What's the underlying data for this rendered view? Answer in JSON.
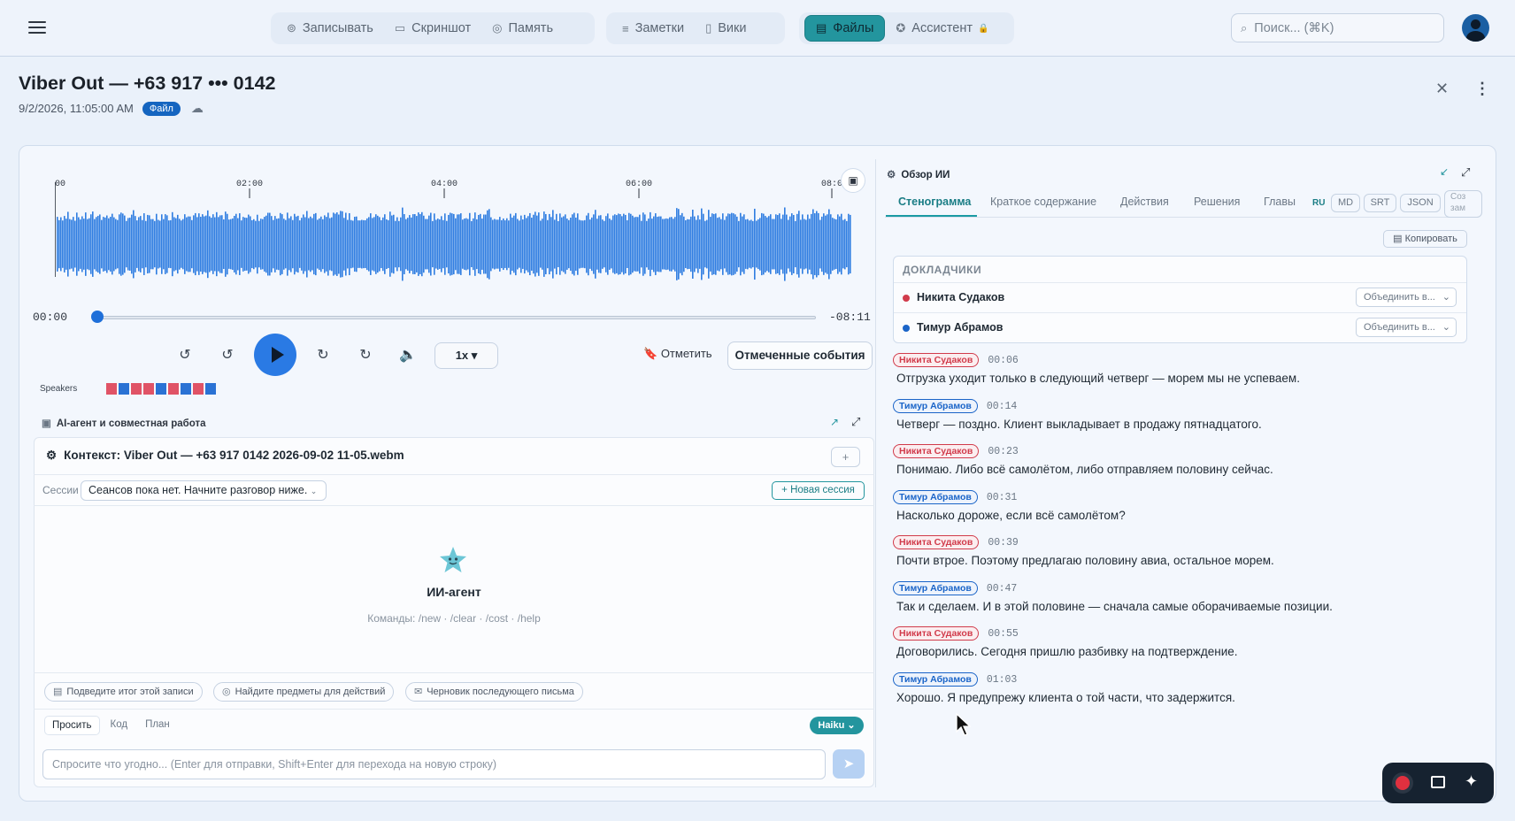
{
  "nav": {
    "groups": [
      [
        {
          "icon": "record-icon",
          "glyph": "⊚",
          "label": "Записывать"
        },
        {
          "icon": "screenshot-icon",
          "glyph": "▭",
          "label": "Скриншот"
        },
        {
          "icon": "memory-icon",
          "glyph": "◎",
          "label": "Память"
        }
      ],
      [
        {
          "icon": "notes-icon",
          "glyph": "≡",
          "label": "Заметки"
        },
        {
          "icon": "wiki-icon",
          "glyph": "▯",
          "label": "Вики"
        }
      ],
      [
        {
          "icon": "files-icon",
          "glyph": "▤",
          "label": "Файлы",
          "active": true
        },
        {
          "icon": "assistant-icon",
          "glyph": "✪",
          "label": "Ассистент",
          "locked": true
        }
      ]
    ],
    "search_placeholder": "Поиск... (⌘K)"
  },
  "header": {
    "title": "Viber Out — +63 917 ••• 0142",
    "datetime": "9/2/2026, 11:05:00 AM",
    "file_badge": "Файл"
  },
  "player": {
    "ruler_labels": [
      "00",
      "02:00",
      "04:00",
      "06:00",
      "08:0"
    ],
    "time_current": "00:00",
    "time_remaining": "-08:11",
    "progress": 0,
    "speed": "1x ▾",
    "mark_label": "Отметить",
    "events_label": "Отмеченные события",
    "speakers_label": "Speakers",
    "speaker_timeline": [
      "red",
      "blue",
      "red",
      "red",
      "blue",
      "red",
      "blue",
      "red",
      "blue"
    ],
    "wave_color": "#2f7de1"
  },
  "ai_agent": {
    "section_title": "AI-агент и совместная работа",
    "context": "Контекст: Viber Out — +63 917 0142 2026-09-02 11-05.webm",
    "sessions_label": "Сессии",
    "sessions_value": "Сеансов пока нет. Начните разговор ниже.",
    "new_session": "Новая сессия",
    "agent_name": "ИИ-агент",
    "commands": "Команды: /new · /clear · /cost · /help",
    "chips": [
      "Подведите итог этой записи",
      "Найдите предметы для действий",
      "Черновик последующего письма"
    ],
    "modes": [
      "Просить",
      "Код",
      "План"
    ],
    "model": "Haiku",
    "input_placeholder": "Спросите что угодно... (Enter для отправки, Shift+Enter для перехода на новую строку)"
  },
  "overview": {
    "title": "Обзор ИИ",
    "tabs": [
      "Стенограмма",
      "Краткое содержание",
      "Действия",
      "Решения",
      "Главы"
    ],
    "active_tab": "Стенограмма",
    "lang": "RU",
    "formats": [
      "MD",
      "SRT",
      "JSON"
    ],
    "create_label": "Соз зам",
    "copy_label": "Копировать",
    "speakers_header": "ДОКЛАДЧИКИ",
    "speakers": [
      {
        "name": "Никита Судаков",
        "color": "#d13b4b",
        "merge": "Объединить в..."
      },
      {
        "name": "Тимур Абрамов",
        "color": "#1a64c8",
        "merge": "Объединить в..."
      }
    ],
    "segments": [
      {
        "speaker": "Никита Судаков",
        "tone": "red",
        "time": "00:06",
        "text": "Отгрузка уходит только в следующий четверг — морем мы не успеваем."
      },
      {
        "speaker": "Тимур Абрамов",
        "tone": "blue",
        "time": "00:14",
        "text": "Четверг — поздно. Клиент выкладывает в продажу пятнадцатого."
      },
      {
        "speaker": "Никита Судаков",
        "tone": "red",
        "time": "00:23",
        "text": "Понимаю. Либо всё самолётом, либо отправляем половину сейчас."
      },
      {
        "speaker": "Тимур Абрамов",
        "tone": "blue",
        "time": "00:31",
        "text": "Насколько дороже, если всё самолётом?"
      },
      {
        "speaker": "Никита Судаков",
        "tone": "red",
        "time": "00:39",
        "text": "Почти втрое. Поэтому предлагаю половину авиа, остальное морем."
      },
      {
        "speaker": "Тимур Абрамов",
        "tone": "blue",
        "time": "00:47",
        "text": "Так и сделаем. И в этой половине — сначала самые оборачиваемые позиции."
      },
      {
        "speaker": "Никита Судаков",
        "tone": "red",
        "time": "00:55",
        "text": "Договорились. Сегодня пришлю разбивку на подтверждение."
      },
      {
        "speaker": "Тимур Абрамов",
        "tone": "blue",
        "time": "01:03",
        "text": "Хорошо. Я предупрежу клиента о той части, что задержится."
      }
    ]
  }
}
